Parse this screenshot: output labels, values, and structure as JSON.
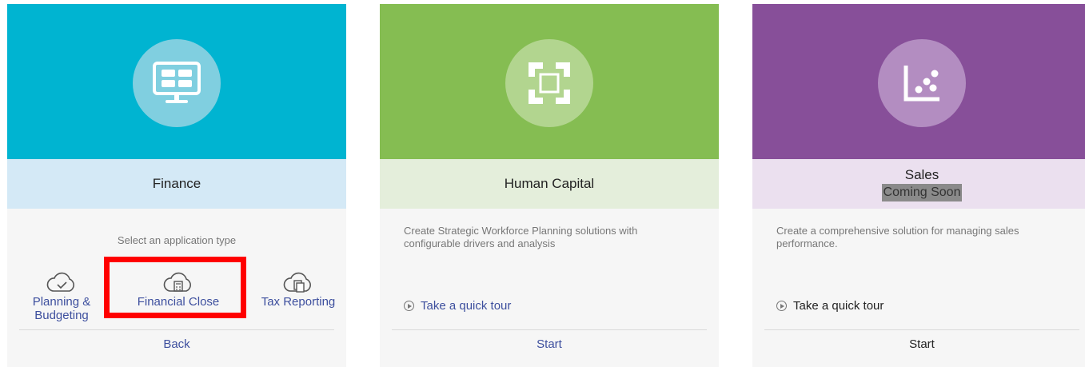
{
  "finance": {
    "title": "Finance",
    "select_label": "Select an application type",
    "app_types": [
      {
        "label": "Planning & Budgeting",
        "icon": "cloud-check-icon"
      },
      {
        "label": "Financial Close",
        "icon": "cloud-calculator-icon"
      },
      {
        "label": "Tax Reporting",
        "icon": "cloud-document-icon"
      }
    ],
    "back_label": "Back",
    "hero_icon": "monitor-dashboard-icon",
    "colors": {
      "hero": "#00b4d1",
      "band": "#d4e9f6"
    }
  },
  "hcm": {
    "title": "Human Capital",
    "description": "Create Strategic Workforce Planning solutions with configurable drivers and analysis",
    "tour_label": "Take a quick tour",
    "start_label": "Start",
    "hero_icon": "focus-frame-icon",
    "colors": {
      "hero": "#85bd52",
      "band": "#e4eedb"
    }
  },
  "sales": {
    "title": "Sales",
    "badge": "Coming Soon",
    "description": "Create a comprehensive solution for managing sales performance.",
    "tour_label": "Take a quick tour",
    "start_label": "Start",
    "hero_icon": "scatter-chart-icon",
    "colors": {
      "hero": "#874f99",
      "band": "#ebe0ef"
    }
  },
  "highlight_color": "#ff0000"
}
